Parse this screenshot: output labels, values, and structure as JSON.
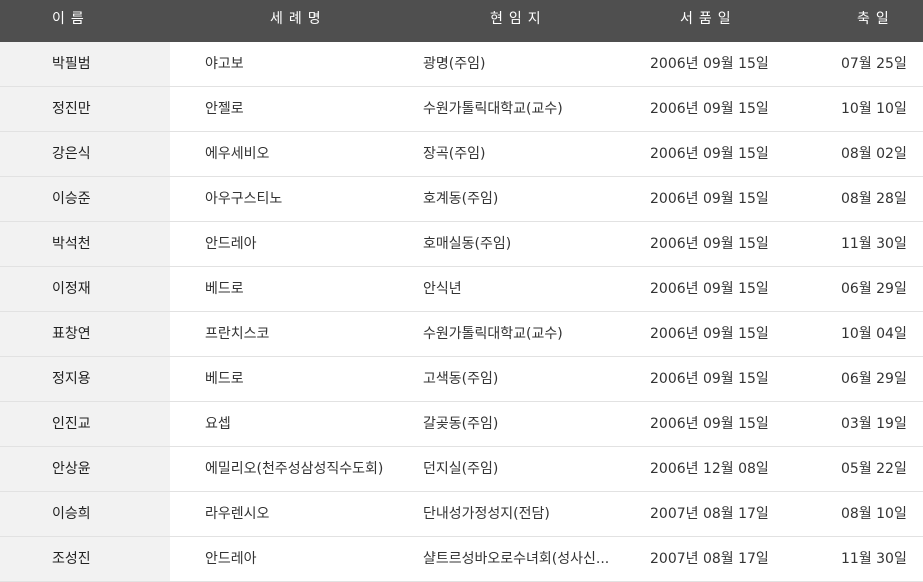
{
  "header": {
    "name": "이름",
    "baptism": "세례명",
    "post": "현임지",
    "ordination": "서품일",
    "feast": "축일"
  },
  "rows": [
    {
      "name": "박필범",
      "baptism": "야고보",
      "post": "광명(주임)",
      "ordination": "2006년 09월 15일",
      "feast": "07월 25일"
    },
    {
      "name": "정진만",
      "baptism": "안젤로",
      "post": "수원가톨릭대학교(교수)",
      "ordination": "2006년 09월 15일",
      "feast": "10월 10일"
    },
    {
      "name": "강은식",
      "baptism": "에우세비오",
      "post": "장곡(주임)",
      "ordination": "2006년 09월 15일",
      "feast": "08월 02일"
    },
    {
      "name": "이승준",
      "baptism": "아우구스티노",
      "post": "호계동(주임)",
      "ordination": "2006년 09월 15일",
      "feast": "08월 28일"
    },
    {
      "name": "박석천",
      "baptism": "안드레아",
      "post": "호매실동(주임)",
      "ordination": "2006년 09월 15일",
      "feast": "11월 30일"
    },
    {
      "name": "이정재",
      "baptism": "베드로",
      "post": "안식년",
      "ordination": "2006년 09월 15일",
      "feast": "06월 29일"
    },
    {
      "name": "표창연",
      "baptism": "프란치스코",
      "post": "수원가톨릭대학교(교수)",
      "ordination": "2006년 09월 15일",
      "feast": "10월 04일"
    },
    {
      "name": "정지용",
      "baptism": "베드로",
      "post": "고색동(주임)",
      "ordination": "2006년 09월 15일",
      "feast": "06월 29일"
    },
    {
      "name": "인진교",
      "baptism": "요셉",
      "post": "갈곶동(주임)",
      "ordination": "2006년 09월 15일",
      "feast": "03월 19일"
    },
    {
      "name": "안상윤",
      "baptism": "에밀리오(천주성삼성직수도회)",
      "post": "던지실(주임)",
      "ordination": "2006년 12월 08일",
      "feast": "05월 22일"
    },
    {
      "name": "이승희",
      "baptism": "라우렌시오",
      "post": "단내성가정성지(전담)",
      "ordination": "2007년 08월 17일",
      "feast": "08월 10일"
    },
    {
      "name": "조성진",
      "baptism": "안드레아",
      "post": "샬트르성바오로수녀회(성사신...",
      "ordination": "2007년 08월 17일",
      "feast": "11월 30일"
    }
  ]
}
